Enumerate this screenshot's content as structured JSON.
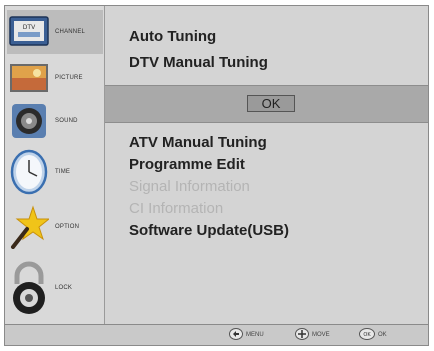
{
  "sidebar": {
    "items": [
      {
        "label": "CHANNEL",
        "icon": "tv-icon"
      },
      {
        "label": "PICTURE",
        "icon": "picture-icon"
      },
      {
        "label": "SOUND",
        "icon": "speaker-icon"
      },
      {
        "label": "TIME",
        "icon": "clock-icon"
      },
      {
        "label": "OPTION",
        "icon": "star-wand-icon"
      },
      {
        "label": "LOCK",
        "icon": "lock-icon"
      }
    ],
    "active_index": 0
  },
  "menu": {
    "top_items": [
      "Auto Tuning",
      "DTV Manual Tuning"
    ],
    "ok_label": "OK",
    "items": [
      {
        "label": "ATV Manual Tuning",
        "enabled": true
      },
      {
        "label": "Programme Edit",
        "enabled": true
      },
      {
        "label": "Signal Information",
        "enabled": false
      },
      {
        "label": "CI Information",
        "enabled": false
      },
      {
        "label": "Software Update(USB)",
        "enabled": true
      }
    ]
  },
  "footer": {
    "menu_hint": "MENU",
    "move_hint": "MOVE",
    "ok_hint": "OK"
  }
}
